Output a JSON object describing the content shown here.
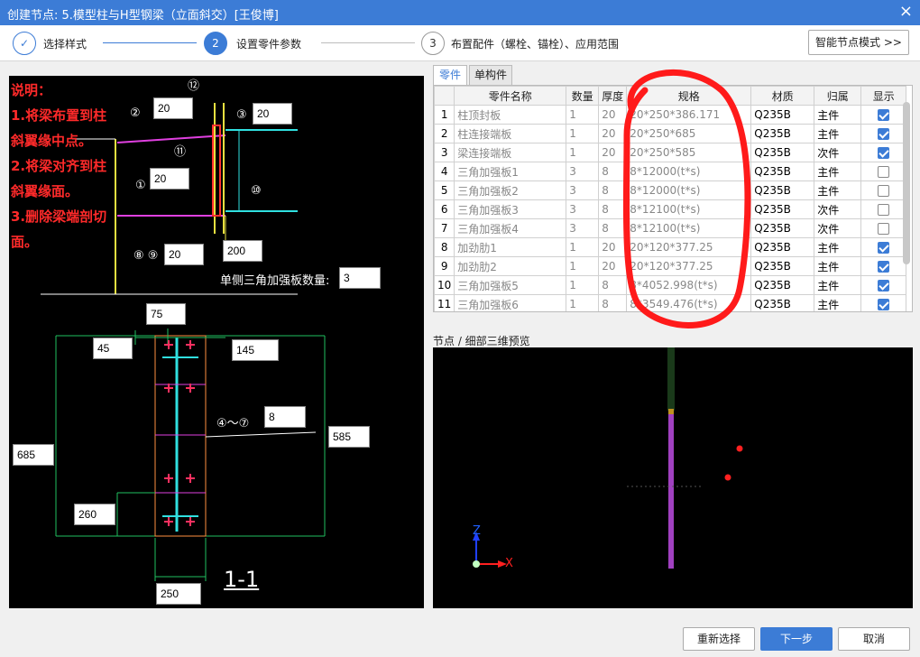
{
  "window": {
    "title": "创建节点: 5.模型柱与H型钢梁（立面斜交）[王俊博]",
    "close_glyph": "×"
  },
  "steps": [
    {
      "num": "✓",
      "label": "选择样式"
    },
    {
      "num": "2",
      "label": "设置零件参数"
    },
    {
      "num": "3",
      "label": "布置配件（螺栓、锚栓）、应用范围"
    }
  ],
  "smart_mode_label": "智能节点模式 >>",
  "notes": [
    "说明：",
    "1.将梁布置到柱",
    "斜翼缘中点。",
    "2.将梁对齐到柱",
    "斜翼缘面。",
    "3.删除梁端剖切",
    "面。"
  ],
  "drawing": {
    "inputs": {
      "p2": "20",
      "p3": "20",
      "p1": "20",
      "p89": "20",
      "p200": "200",
      "triangle_qty": "3",
      "p75": "75",
      "p45": "45",
      "p145": "145",
      "p8": "8",
      "p585": "585",
      "p685": "685",
      "p260": "260",
      "p250": "250"
    },
    "labels": {
      "triangle_qty": "单侧三角加强板数量:",
      "range47": "④～⑦",
      "section": "1-1",
      "c1": "①",
      "c2": "②",
      "c3": "③",
      "c10": "⑩",
      "c11": "⑪",
      "c12": "⑫",
      "c89": "⑧ ⑨"
    }
  },
  "tabs": [
    "零件",
    "单构件"
  ],
  "table": {
    "headers": [
      "",
      "零件名称",
      "数量",
      "厚度",
      "规格",
      "材质",
      "归属",
      "显示"
    ],
    "rows": [
      {
        "idx": "1",
        "name": "柱顶封板",
        "qty": "1",
        "thk": "20",
        "spec": "20*250*386.171",
        "mat": "Q235B",
        "owner": "主件",
        "show": true
      },
      {
        "idx": "2",
        "name": "柱连接端板",
        "qty": "1",
        "thk": "20",
        "spec": "20*250*685",
        "mat": "Q235B",
        "owner": "主件",
        "show": true
      },
      {
        "idx": "3",
        "name": "梁连接端板",
        "qty": "1",
        "thk": "20",
        "spec": "20*250*585",
        "mat": "Q235B",
        "owner": "次件",
        "show": true
      },
      {
        "idx": "4",
        "name": "三角加强板1",
        "qty": "3",
        "thk": "8",
        "spec": "8*12000(t*s)",
        "mat": "Q235B",
        "owner": "主件",
        "show": false
      },
      {
        "idx": "5",
        "name": "三角加强板2",
        "qty": "3",
        "thk": "8",
        "spec": "8*12000(t*s)",
        "mat": "Q235B",
        "owner": "主件",
        "show": false
      },
      {
        "idx": "6",
        "name": "三角加强板3",
        "qty": "3",
        "thk": "8",
        "spec": "8*12100(t*s)",
        "mat": "Q235B",
        "owner": "次件",
        "show": false
      },
      {
        "idx": "7",
        "name": "三角加强板4",
        "qty": "3",
        "thk": "8",
        "spec": "8*12100(t*s)",
        "mat": "Q235B",
        "owner": "次件",
        "show": false
      },
      {
        "idx": "8",
        "name": "加劲肋1",
        "qty": "1",
        "thk": "20",
        "spec": "20*120*377.25",
        "mat": "Q235B",
        "owner": "主件",
        "show": true
      },
      {
        "idx": "9",
        "name": "加劲肋2",
        "qty": "1",
        "thk": "20",
        "spec": "20*120*377.25",
        "mat": "Q235B",
        "owner": "主件",
        "show": true
      },
      {
        "idx": "10",
        "name": "三角加强板5",
        "qty": "1",
        "thk": "8",
        "spec": "8*4052.998(t*s)",
        "mat": "Q235B",
        "owner": "主件",
        "show": true
      },
      {
        "idx": "11",
        "name": "三角加强板6",
        "qty": "1",
        "thk": "8",
        "spec": "8*3549.476(t*s)",
        "mat": "Q235B",
        "owner": "主件",
        "show": true
      }
    ]
  },
  "preview": {
    "title": "节点 / 细部三维预览",
    "axis_z": "Z",
    "axis_x": "X"
  },
  "buttons": {
    "reselect": "重新选择",
    "next": "下一步",
    "cancel": "取消"
  },
  "colors": {
    "accent": "#3c7cd6",
    "annotation_red": "#ff2a2a"
  }
}
